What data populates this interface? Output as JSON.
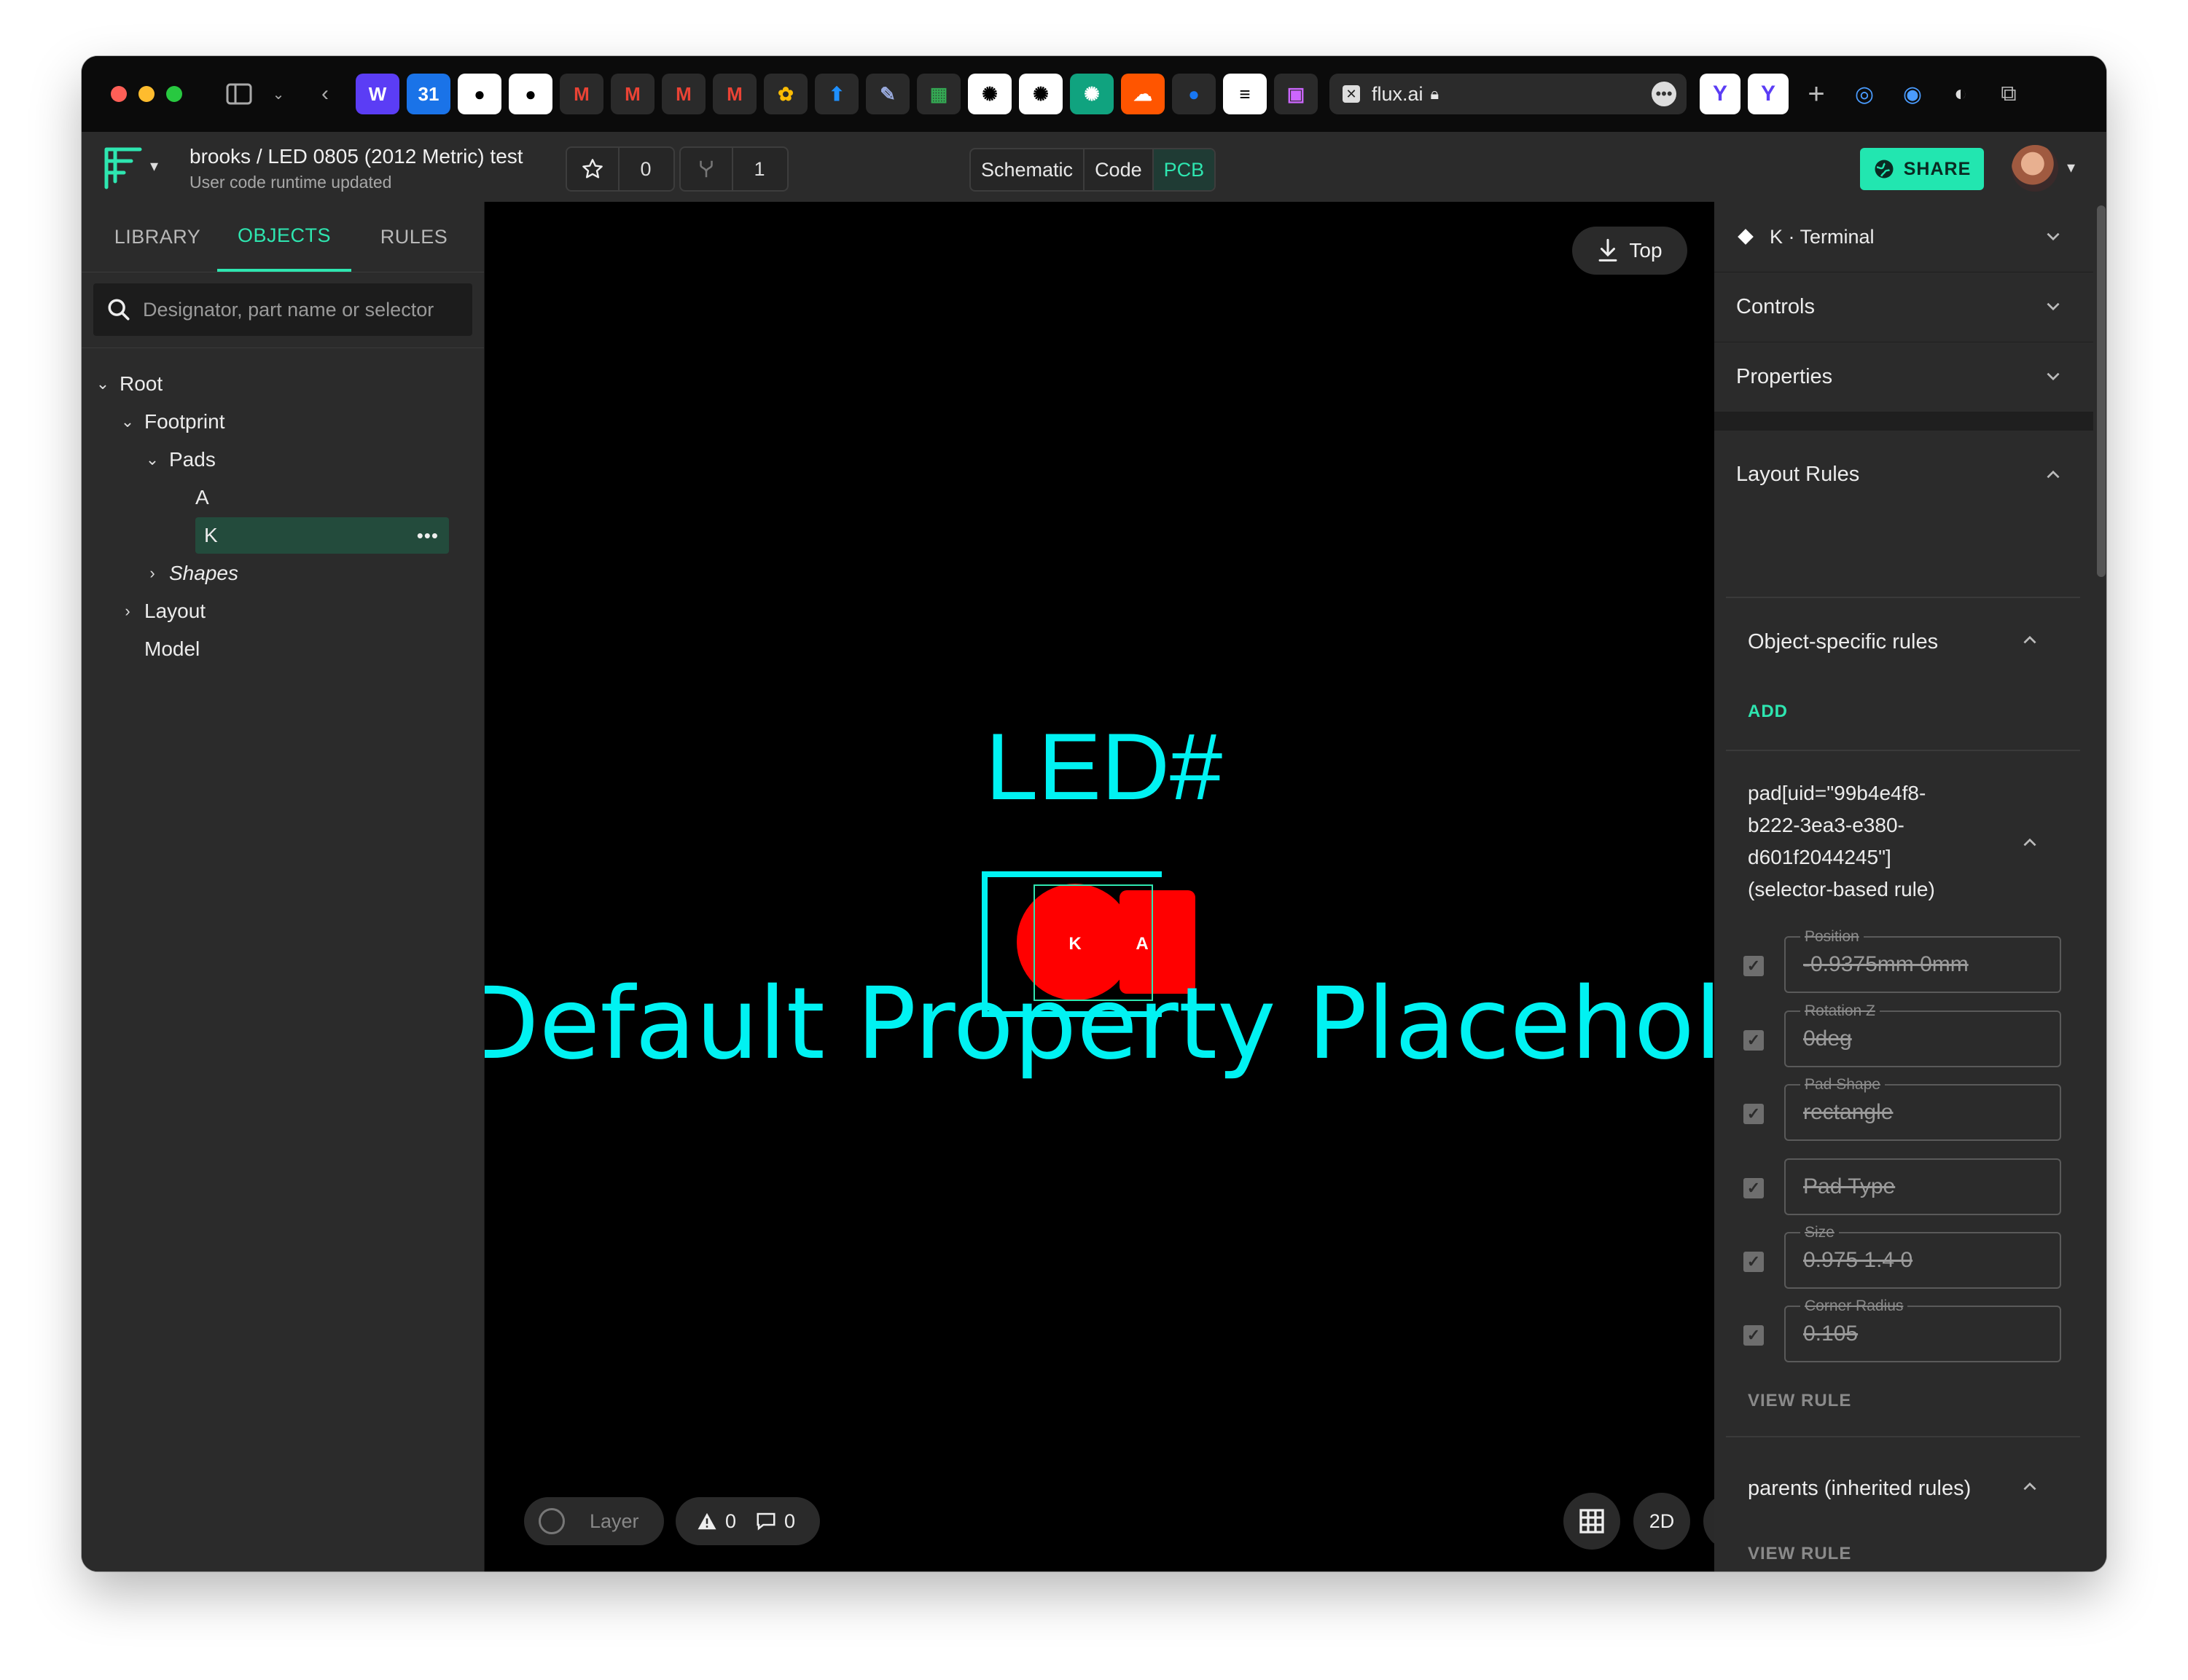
{
  "browser": {
    "url": "flux.ai",
    "traffic_colors": [
      "#fe5f57",
      "#febc2e",
      "#28c840"
    ]
  },
  "header": {
    "project_title": "brooks / LED 0805 (2012 Metric) test",
    "project_subtitle": "User code runtime updated",
    "star_count": "0",
    "fork_count": "1",
    "modes": [
      "Schematic",
      "Code",
      "PCB"
    ],
    "active_mode": "PCB",
    "share_label": "SHARE"
  },
  "left_panel": {
    "tabs": [
      "LIBRARY",
      "OBJECTS",
      "RULES"
    ],
    "active_tab": "OBJECTS",
    "search_placeholder": "Designator, part name or selector",
    "tree": {
      "root": "Root",
      "footprint": "Footprint",
      "pads": "Pads",
      "pad_a": "A",
      "pad_k": "K",
      "shapes": "Shapes",
      "layout": "Layout",
      "model": "Model"
    }
  },
  "canvas": {
    "view_button": "Top",
    "designator_label": "LED#",
    "value_label": "Default Property Placeholder",
    "pad_k_label": "K",
    "pad_a_label": "A",
    "layer_label": "Layer",
    "warnings_count": "0",
    "comments_count": "0",
    "mode_2d": "2D",
    "colors": {
      "silkscreen": "#00f2f2",
      "pad": "#ff0000",
      "accent": "#2ee6b0"
    }
  },
  "right_panel": {
    "selected_header": "K · Terminal",
    "controls": "Controls",
    "properties": "Properties",
    "layout_rules": "Layout Rules",
    "object_specific_rules": "Object-specific rules",
    "add_label": "ADD",
    "selector_rule_lines": [
      "pad[uid=\"99b4e4f8-",
      "b222-3ea3-e380-",
      "d601f2044245\"]",
      "(selector-based rule)"
    ],
    "fields": [
      {
        "label": "Position",
        "value": "-0.9375mm 0mm"
      },
      {
        "label": "Rotation Z",
        "value": "0deg"
      },
      {
        "label": "Pad Shape",
        "value": "rectangle"
      },
      {
        "label": "",
        "value": "Pad Type"
      },
      {
        "label": "Size",
        "value": "0.975 1.4 0"
      },
      {
        "label": "Corner Radius",
        "value": "0.105"
      }
    ],
    "view_rule_label": "VIEW RULE",
    "parents_rules": "parents (inherited rules)",
    "view_rule_label_2": "VIEW RULE"
  }
}
